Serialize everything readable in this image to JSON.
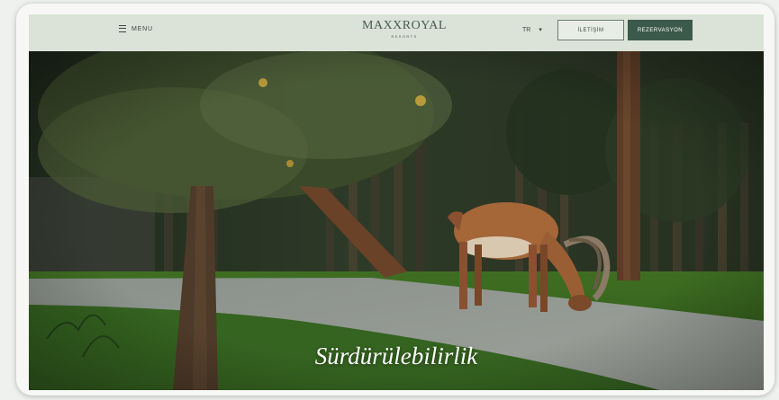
{
  "header": {
    "menu_label": "MENU",
    "logo_text": "MAXXROYAL",
    "logo_subtext": "RESORTS",
    "language": "TR",
    "contact_label": "İLETİŞİM",
    "reserve_label": "REZERVASYON"
  },
  "hero": {
    "title": "Sürdürülebilirlik"
  },
  "colors": {
    "header_bg": "#dbe2d8",
    "brand_green": "#3c5a4b",
    "grass": "#3c6a22"
  }
}
